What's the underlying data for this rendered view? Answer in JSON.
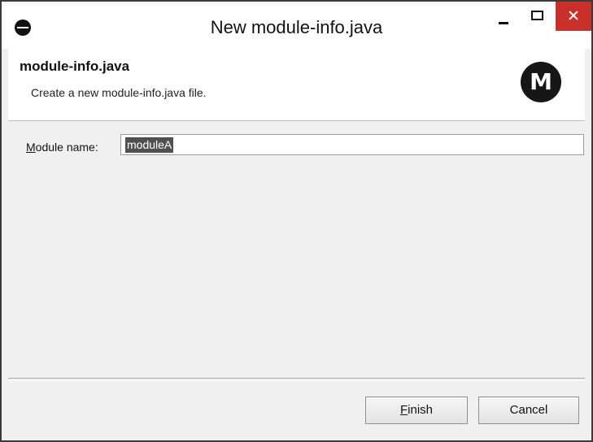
{
  "window": {
    "title": "New module-info.java"
  },
  "header": {
    "title": "module-info.java",
    "description": "Create a new module-info.java file.",
    "logo_letter": "M"
  },
  "form": {
    "module_name_label_mnemonic": "M",
    "module_name_label_rest": "odule name:",
    "module_name_value": "moduleA"
  },
  "buttons": {
    "finish_mnemonic": "F",
    "finish_rest": "inish",
    "cancel": "Cancel"
  },
  "colors": {
    "close_button": "#c7302b",
    "selection": "#505050"
  }
}
